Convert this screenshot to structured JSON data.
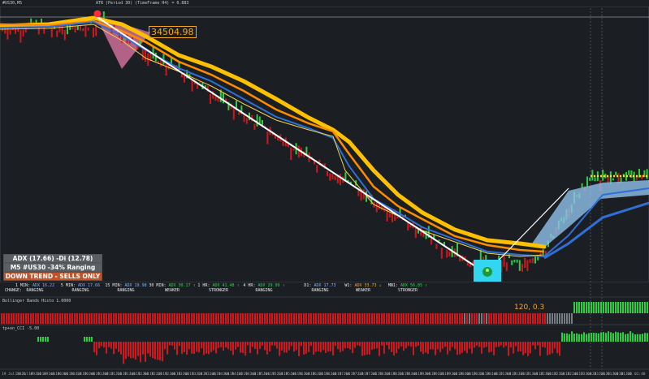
{
  "window": {
    "symbol_label": "#US30,M5",
    "atr_label": "ATR (Period 30) (TimeFrame H4) = 0.883"
  },
  "price_tag": "34504.98",
  "info_boxes": {
    "adx": "ADX (17.66)  -Di (12.78)",
    "ranging": "M5 #US30 -34% Ranging",
    "trend": "DOWN TREND - SELLS ONLY"
  },
  "change_label": "CHANGE:",
  "timeframes": [
    {
      "tf": "1 MIN:",
      "adx": "ADX 16.22",
      "state": "RANGING",
      "color": "blue"
    },
    {
      "tf": "5 MIN:",
      "adx": "ADX 17.66",
      "state": "RANGING",
      "color": "blue"
    },
    {
      "tf": "15 MIN:",
      "adx": "ADX 19.98",
      "state": "RANGING",
      "color": "blue"
    },
    {
      "tf": "30 MIN:",
      "adx": "ADX 30.17 ↑",
      "state": "WEAKER",
      "color": "green"
    },
    {
      "tf": "1 HR:",
      "adx": "ADX 41.48 ↑",
      "state": "STRONGER",
      "color": "green"
    },
    {
      "tf": "4 HR:",
      "adx": "ADX 29.99 ↑",
      "state": "RANGING",
      "color": "green"
    },
    {
      "tf": "D1:",
      "adx": "ADX 17.73",
      "state": "RANGING",
      "color": "blue"
    },
    {
      "tf": "W1:",
      "adx": "ADX 33.73 ↓",
      "state": "WEAKER",
      "color": "orange"
    },
    {
      "tf": "MN1:",
      "adx": "ADX 56.85 ↑",
      "state": "STRONGER",
      "color": "green"
    }
  ],
  "sub1": {
    "label": "Bollinger Bands Histo 1.0000",
    "value": "120, 0.3"
  },
  "sub2": {
    "label": "tp+on_CCI -5.00"
  },
  "time_ticks": [
    "19 Jul 2021",
    "19 Jul 09:20",
    "19 Jul 09:40",
    "19 Jul 10:00",
    "19 Jul 10:20",
    "19 Jul 10:40",
    "19 Jul 11:00",
    "19 Jul 11:20",
    "19 Jul 11:40",
    "19 Jul 12:00",
    "19 Jul 12:20",
    "19 Jul 12:40",
    "19 Jul 13:00",
    "19 Jul 13:20",
    "19 Jul 13:40",
    "19 Jul 14:00",
    "19 Jul 14:20",
    "19 Jul 14:40",
    "19 Jul 15:00",
    "19 Jul 15:20",
    "19 Jul 15:40",
    "19 Jul 16:00",
    "19 Jul 16:20",
    "19 Jul 16:40",
    "19 Jul 17:00",
    "19 Jul 17:20",
    "19 Jul 17:40",
    "19 Jul 18:00",
    "19 Jul 18:20",
    "19 Jul 18:40",
    "19 Jul 19:00",
    "19 Jul 19:20",
    "19 Jul 19:40",
    "19 Jul 20:00",
    "19 Jul 20:20",
    "19 Jul 20:40",
    "19 Jul 21:00",
    "19 Jul 21:20",
    "19 Jul 21:40",
    "19 Jul 22:00",
    "19 Jul 22:20",
    "19 Jul 22:40",
    "19 Jul 23:00",
    "19 Jul 23:20",
    "20 Jul 01:00",
    "20 Jul 01:20",
    "20 Jul 01:40"
  ],
  "colors": {
    "bg": "#1b1f24",
    "bull": "#2ecc40",
    "bear": "#d0181c",
    "gold": "#ffc000",
    "orange": "#ff8c00",
    "blue": "#2f6fd6",
    "light_blue": "#7fb7e8"
  }
}
